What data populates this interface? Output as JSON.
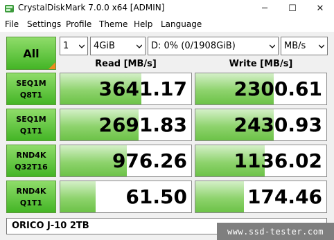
{
  "window": {
    "title": "CrystalDiskMark 7.0.0 x64 [ADMIN]",
    "minimize": "─",
    "maximize": "☐",
    "close": "✕"
  },
  "menu": [
    "File",
    "Settings",
    "Profile",
    "Theme",
    "Help",
    "Language"
  ],
  "controls": {
    "all_label": "All",
    "count": "1",
    "size": "4GiB",
    "drive": "D: 0% (0/1908GiB)",
    "unit": "MB/s"
  },
  "headers": {
    "read": "Read [MB/s]",
    "write": "Write [MB/s]"
  },
  "rows": [
    {
      "line1": "SEQ1M",
      "line2": "Q8T1",
      "read": "3641.17",
      "write": "2300.61",
      "read_fill": 0.62,
      "write_fill": 0.6
    },
    {
      "line1": "SEQ1M",
      "line2": "Q1T1",
      "read": "2691.83",
      "write": "2430.93",
      "read_fill": 0.6,
      "write_fill": 0.6
    },
    {
      "line1": "RND4K",
      "line2": "Q32T16",
      "read": "976.26",
      "write": "1136.02",
      "read_fill": 0.51,
      "write_fill": 0.53
    },
    {
      "line1": "RND4K",
      "line2": "Q1T1",
      "read": "61.50",
      "write": "174.46",
      "read_fill": 0.27,
      "write_fill": 0.37
    }
  ],
  "comment": "ORICO J-10 2TB",
  "watermark": "www.ssd-tester.com",
  "colors": {
    "button_green": "#44b526",
    "bar_green": "#8ed36d",
    "corner_orange": "#f08a1e"
  }
}
